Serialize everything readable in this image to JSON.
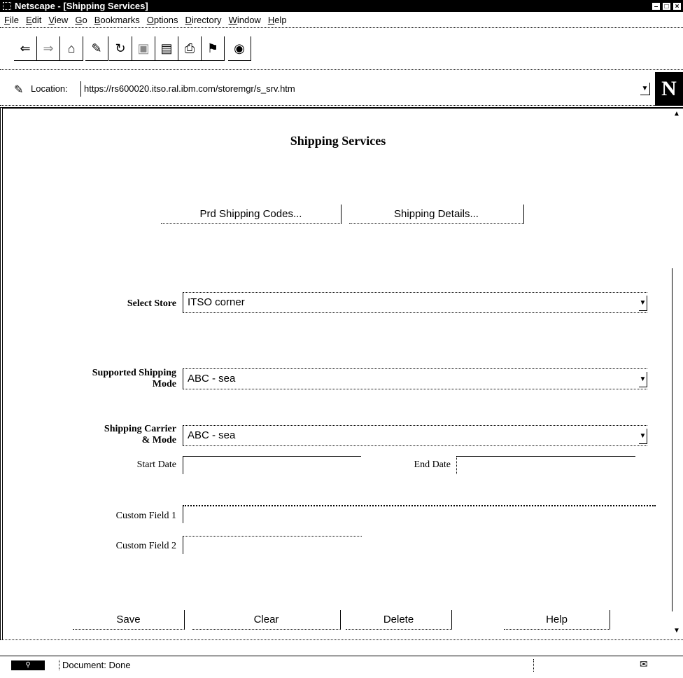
{
  "window": {
    "title": "Netscape - [Shipping Services]"
  },
  "menu": {
    "items": [
      {
        "m": "F",
        "rest": "ile"
      },
      {
        "m": "E",
        "rest": "dit"
      },
      {
        "m": "V",
        "rest": "iew"
      },
      {
        "m": "G",
        "rest": "o"
      },
      {
        "m": "B",
        "rest": "ookmarks"
      },
      {
        "m": "O",
        "rest": "ptions"
      },
      {
        "m": "D",
        "rest": "irectory"
      },
      {
        "m": "W",
        "rest": "indow"
      },
      {
        "m": "H",
        "rest": "elp"
      }
    ]
  },
  "toolbar": {
    "icons": [
      "back-icon",
      "forward-icon",
      "home-icon",
      "edit-icon",
      "reload-icon",
      "images-icon",
      "open-icon",
      "print-icon",
      "find-icon",
      "stop-icon"
    ]
  },
  "location": {
    "label": "Location:",
    "url": "https://rs600020.itso.ral.ibm.com/storemgr/s_srv.htm"
  },
  "page": {
    "title": "Shipping Services",
    "prd_codes_button": "Prd Shipping Codes...",
    "details_button": "Shipping Details...",
    "select_store_label": "Select Store",
    "select_store_value": "ITSO corner",
    "shipping_mode_label_1": "Supported Shipping",
    "shipping_mode_label_2": "Mode",
    "shipping_mode_value": "ABC - sea",
    "carrier_label_1": "Shipping Carrier",
    "carrier_label_2": "& Mode",
    "carrier_value": "ABC - sea",
    "start_date_label": "Start Date",
    "end_date_label": "End Date",
    "custom1_label": "Custom Field 1",
    "custom2_label": "Custom Field 2",
    "save_button": "Save",
    "clear_button": "Clear",
    "delete_button": "Delete",
    "help_button": "Help"
  },
  "status": {
    "text": "Document: Done"
  }
}
